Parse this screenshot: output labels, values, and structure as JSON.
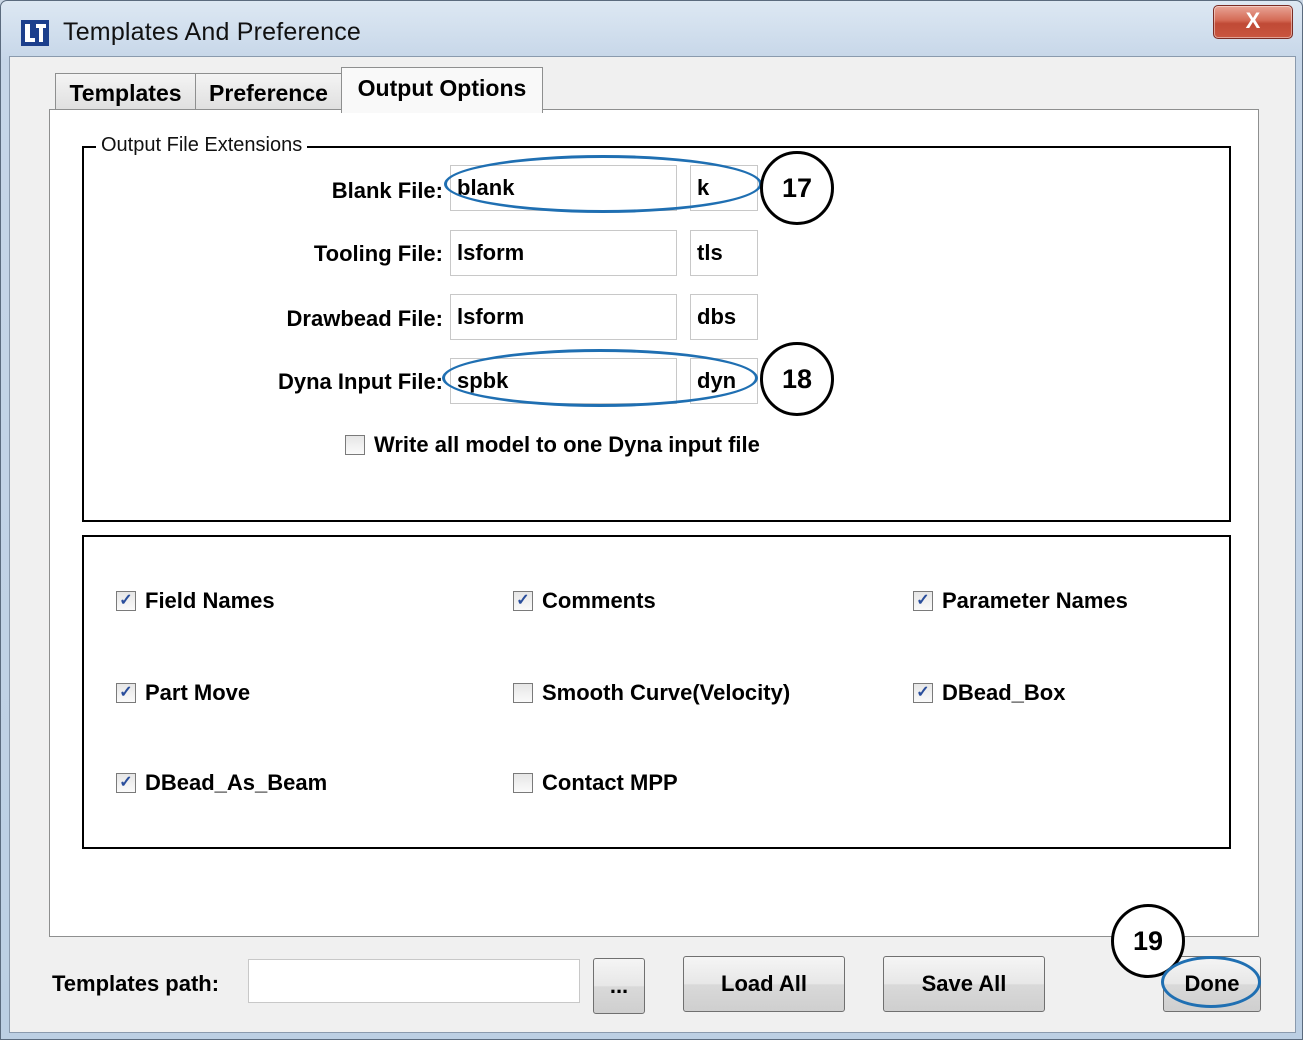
{
  "window": {
    "title": "Templates And Preference",
    "close_label": "X"
  },
  "tabs": [
    {
      "label": "Templates",
      "active": false
    },
    {
      "label": "Preference",
      "active": false
    },
    {
      "label": "Output Options",
      "active": true
    }
  ],
  "output_extensions": {
    "legend": "Output File Extensions",
    "rows": [
      {
        "label": "Blank File:",
        "name": "blank",
        "ext": "k"
      },
      {
        "label": "Tooling File:",
        "name": "lsform",
        "ext": "tls"
      },
      {
        "label": "Drawbead File:",
        "name": "lsform",
        "ext": "dbs"
      },
      {
        "label": "Dyna Input File:",
        "name": "spbk",
        "ext": "dyn"
      }
    ],
    "write_all": {
      "label": "Write all model to one Dyna input file",
      "checked": false
    }
  },
  "options": [
    {
      "label": "Field Names",
      "checked": true
    },
    {
      "label": "Comments",
      "checked": true
    },
    {
      "label": "Parameter Names",
      "checked": true
    },
    {
      "label": "Part Move",
      "checked": true
    },
    {
      "label": "Smooth Curve(Velocity)",
      "checked": false
    },
    {
      "label": "DBead_Box",
      "checked": true
    },
    {
      "label": "DBead_As_Beam",
      "checked": true
    },
    {
      "label": "Contact MPP",
      "checked": false
    }
  ],
  "bottom": {
    "templates_path_label": "Templates path:",
    "templates_path_value": "",
    "browse_label": "...",
    "load_all_label": "Load All",
    "save_all_label": "Save All",
    "done_label": "Done"
  },
  "callouts": [
    "17",
    "18",
    "19"
  ],
  "colors": {
    "annotation_oval": "#1f6fb2",
    "check_mark": "#2a4e9c"
  }
}
